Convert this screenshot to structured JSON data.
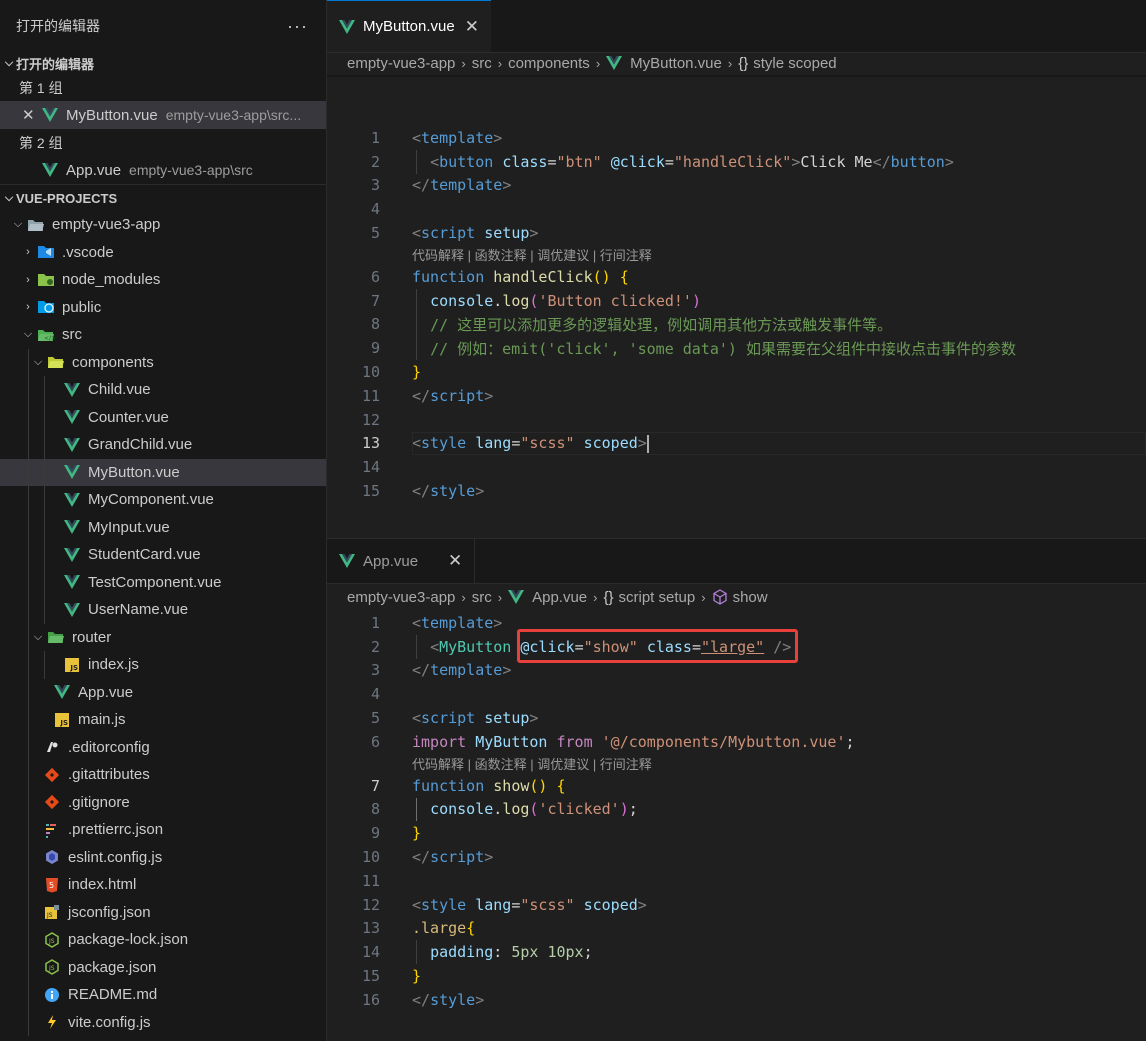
{
  "sidebar": {
    "header_title": "打开的编辑器",
    "more": "···",
    "open_editors": {
      "title": "打开的编辑器",
      "groups": [
        {
          "label": "第 1 组",
          "items": [
            {
              "name": "MyButton.vue",
              "desc": "empty-vue3-app\\src..."
            }
          ]
        },
        {
          "label": "第 2 组",
          "items": [
            {
              "name": "App.vue",
              "desc": "empty-vue3-app\\src"
            }
          ]
        }
      ]
    },
    "explorer": {
      "title": "VUE-PROJECTS",
      "items": [
        {
          "label": "empty-vue3-app"
        },
        {
          "label": ".vscode"
        },
        {
          "label": "node_modules"
        },
        {
          "label": "public"
        },
        {
          "label": "src"
        },
        {
          "label": "components"
        },
        {
          "label": "Child.vue"
        },
        {
          "label": "Counter.vue"
        },
        {
          "label": "GrandChild.vue"
        },
        {
          "label": "MyButton.vue"
        },
        {
          "label": "MyComponent.vue"
        },
        {
          "label": "MyInput.vue"
        },
        {
          "label": "StudentCard.vue"
        },
        {
          "label": "TestComponent.vue"
        },
        {
          "label": "UserName.vue"
        },
        {
          "label": "router"
        },
        {
          "label": "index.js"
        },
        {
          "label": "App.vue"
        },
        {
          "label": "main.js"
        },
        {
          "label": ".editorconfig"
        },
        {
          "label": ".gitattributes"
        },
        {
          "label": ".gitignore"
        },
        {
          "label": ".prettierrc.json"
        },
        {
          "label": "eslint.config.js"
        },
        {
          "label": "index.html"
        },
        {
          "label": "jsconfig.json"
        },
        {
          "label": "package-lock.json"
        },
        {
          "label": "package.json"
        },
        {
          "label": "README.md"
        },
        {
          "label": "vite.config.js"
        }
      ]
    }
  },
  "editor_top": {
    "tab_label": "MyButton.vue",
    "close": "✕",
    "breadcrumbs": [
      "empty-vue3-app",
      "src",
      "components",
      "MyButton.vue",
      "style scoped"
    ],
    "codelens": "代码解释 | 函数注释 | 调优建议 | 行间注释",
    "lines": [
      "1",
      "2",
      "3",
      "4",
      "5",
      "6",
      "7",
      "8",
      "9",
      "10",
      "11",
      "12",
      "13",
      "14",
      "15"
    ]
  },
  "editor_bottom": {
    "tab_label": "App.vue",
    "close": "✕",
    "breadcrumbs": [
      "empty-vue3-app",
      "src",
      "App.vue",
      "script setup",
      "show"
    ],
    "codelens": "代码解释 | 函数注释 | 调优建议 | 行间注释",
    "lines": [
      "1",
      "2",
      "3",
      "4",
      "5",
      "6",
      "7",
      "8",
      "9",
      "10",
      "11",
      "12",
      "13",
      "14",
      "15",
      "16"
    ]
  },
  "colors": {
    "accent": "#0078d4",
    "vue": "#41b883",
    "highlight": "#e8413c"
  }
}
